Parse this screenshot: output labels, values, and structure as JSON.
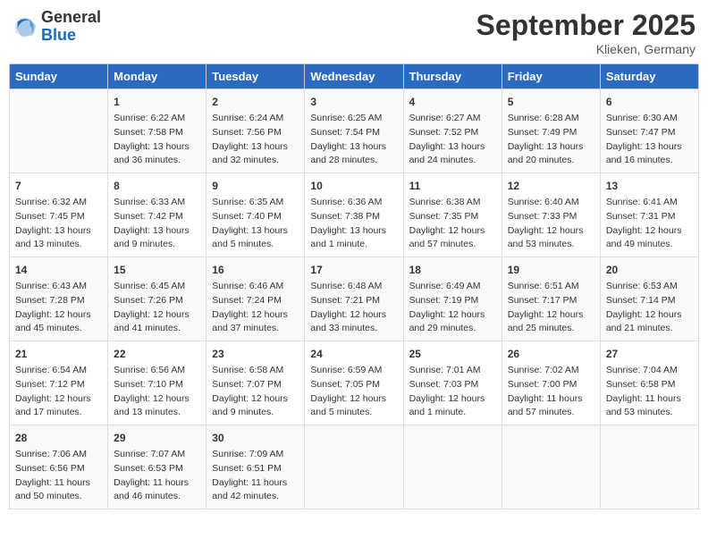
{
  "header": {
    "logo_general": "General",
    "logo_blue": "Blue",
    "month": "September 2025",
    "location": "Klieken, Germany"
  },
  "weekdays": [
    "Sunday",
    "Monday",
    "Tuesday",
    "Wednesday",
    "Thursday",
    "Friday",
    "Saturday"
  ],
  "weeks": [
    [
      {
        "day": "",
        "info": ""
      },
      {
        "day": "1",
        "info": "Sunrise: 6:22 AM\nSunset: 7:58 PM\nDaylight: 13 hours and 36 minutes."
      },
      {
        "day": "2",
        "info": "Sunrise: 6:24 AM\nSunset: 7:56 PM\nDaylight: 13 hours and 32 minutes."
      },
      {
        "day": "3",
        "info": "Sunrise: 6:25 AM\nSunset: 7:54 PM\nDaylight: 13 hours and 28 minutes."
      },
      {
        "day": "4",
        "info": "Sunrise: 6:27 AM\nSunset: 7:52 PM\nDaylight: 13 hours and 24 minutes."
      },
      {
        "day": "5",
        "info": "Sunrise: 6:28 AM\nSunset: 7:49 PM\nDaylight: 13 hours and 20 minutes."
      },
      {
        "day": "6",
        "info": "Sunrise: 6:30 AM\nSunset: 7:47 PM\nDaylight: 13 hours and 16 minutes."
      }
    ],
    [
      {
        "day": "7",
        "info": "Sunrise: 6:32 AM\nSunset: 7:45 PM\nDaylight: 13 hours and 13 minutes."
      },
      {
        "day": "8",
        "info": "Sunrise: 6:33 AM\nSunset: 7:42 PM\nDaylight: 13 hours and 9 minutes."
      },
      {
        "day": "9",
        "info": "Sunrise: 6:35 AM\nSunset: 7:40 PM\nDaylight: 13 hours and 5 minutes."
      },
      {
        "day": "10",
        "info": "Sunrise: 6:36 AM\nSunset: 7:38 PM\nDaylight: 13 hours and 1 minute."
      },
      {
        "day": "11",
        "info": "Sunrise: 6:38 AM\nSunset: 7:35 PM\nDaylight: 12 hours and 57 minutes."
      },
      {
        "day": "12",
        "info": "Sunrise: 6:40 AM\nSunset: 7:33 PM\nDaylight: 12 hours and 53 minutes."
      },
      {
        "day": "13",
        "info": "Sunrise: 6:41 AM\nSunset: 7:31 PM\nDaylight: 12 hours and 49 minutes."
      }
    ],
    [
      {
        "day": "14",
        "info": "Sunrise: 6:43 AM\nSunset: 7:28 PM\nDaylight: 12 hours and 45 minutes."
      },
      {
        "day": "15",
        "info": "Sunrise: 6:45 AM\nSunset: 7:26 PM\nDaylight: 12 hours and 41 minutes."
      },
      {
        "day": "16",
        "info": "Sunrise: 6:46 AM\nSunset: 7:24 PM\nDaylight: 12 hours and 37 minutes."
      },
      {
        "day": "17",
        "info": "Sunrise: 6:48 AM\nSunset: 7:21 PM\nDaylight: 12 hours and 33 minutes."
      },
      {
        "day": "18",
        "info": "Sunrise: 6:49 AM\nSunset: 7:19 PM\nDaylight: 12 hours and 29 minutes."
      },
      {
        "day": "19",
        "info": "Sunrise: 6:51 AM\nSunset: 7:17 PM\nDaylight: 12 hours and 25 minutes."
      },
      {
        "day": "20",
        "info": "Sunrise: 6:53 AM\nSunset: 7:14 PM\nDaylight: 12 hours and 21 minutes."
      }
    ],
    [
      {
        "day": "21",
        "info": "Sunrise: 6:54 AM\nSunset: 7:12 PM\nDaylight: 12 hours and 17 minutes."
      },
      {
        "day": "22",
        "info": "Sunrise: 6:56 AM\nSunset: 7:10 PM\nDaylight: 12 hours and 13 minutes."
      },
      {
        "day": "23",
        "info": "Sunrise: 6:58 AM\nSunset: 7:07 PM\nDaylight: 12 hours and 9 minutes."
      },
      {
        "day": "24",
        "info": "Sunrise: 6:59 AM\nSunset: 7:05 PM\nDaylight: 12 hours and 5 minutes."
      },
      {
        "day": "25",
        "info": "Sunrise: 7:01 AM\nSunset: 7:03 PM\nDaylight: 12 hours and 1 minute."
      },
      {
        "day": "26",
        "info": "Sunrise: 7:02 AM\nSunset: 7:00 PM\nDaylight: 11 hours and 57 minutes."
      },
      {
        "day": "27",
        "info": "Sunrise: 7:04 AM\nSunset: 6:58 PM\nDaylight: 11 hours and 53 minutes."
      }
    ],
    [
      {
        "day": "28",
        "info": "Sunrise: 7:06 AM\nSunset: 6:56 PM\nDaylight: 11 hours and 50 minutes."
      },
      {
        "day": "29",
        "info": "Sunrise: 7:07 AM\nSunset: 6:53 PM\nDaylight: 11 hours and 46 minutes."
      },
      {
        "day": "30",
        "info": "Sunrise: 7:09 AM\nSunset: 6:51 PM\nDaylight: 11 hours and 42 minutes."
      },
      {
        "day": "",
        "info": ""
      },
      {
        "day": "",
        "info": ""
      },
      {
        "day": "",
        "info": ""
      },
      {
        "day": "",
        "info": ""
      }
    ]
  ]
}
